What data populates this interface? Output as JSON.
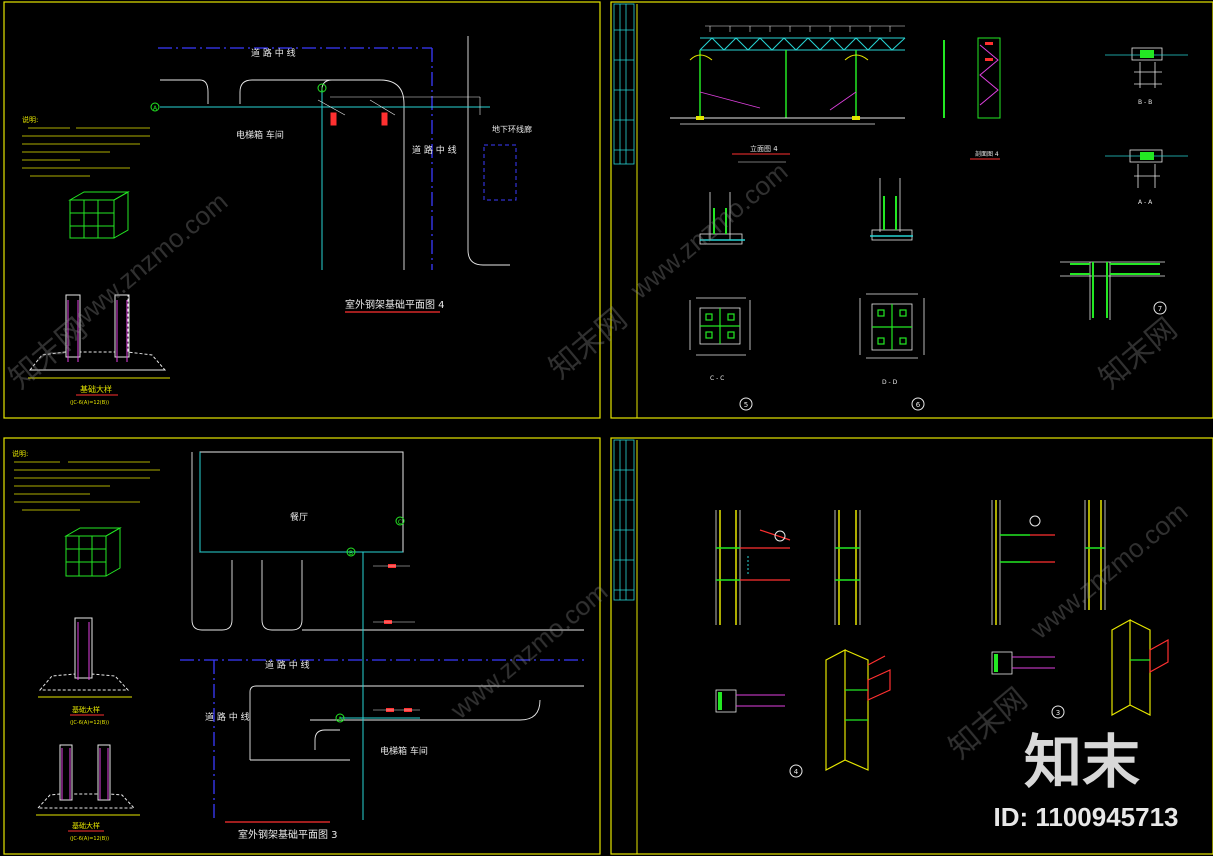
{
  "colors": {
    "frame": "#e6e600",
    "road": "#3b3bff",
    "cyan": "#27d3d3",
    "green": "#23e823",
    "white": "#e8e8e8",
    "magenta": "#e040e0",
    "red": "#ff3030",
    "watermark": "#8a8a8a"
  },
  "panel_tl": {
    "road_label_top": "道 路 中 线",
    "road_label_right": "道 路 中 线",
    "elevator_room": "电梯箱   车间",
    "corridor": "地下环线廊",
    "axis_a": "A",
    "axis_1": "1",
    "title": "室外钢架基础平面图 4",
    "foundation_detail": "基础大样",
    "foundation_note": "(JC-6(A)=12(B))",
    "notes_heading": "说明:"
  },
  "panel_tr": {
    "elevation_title": "立面图 4",
    "side_title": "剖面图 4",
    "section_bb": "B - B",
    "section_aa": "A - A",
    "section_cc": "C - C",
    "section_dd": "D - D",
    "callout_5": "5",
    "callout_6": "6",
    "callout_7": "7"
  },
  "panel_bl": {
    "notes_heading": "说明:",
    "restaurant": "餐厅",
    "road_label_mid": "道 路 中 线",
    "road_label_left": "道 路 中 线",
    "elevator_room": "电梯箱   车间",
    "axis_a": "A",
    "axis_b": "B",
    "axis_c": "C",
    "title": "室外钢架基础平面图 3",
    "foundation_detail_1": "基础大样",
    "foundation_detail_2": "基础大样",
    "foundation_note_1": "(JC-6(A)=12(B))",
    "foundation_note_2": "(JC-6(A)=12(B))"
  },
  "panel_br": {
    "callout_4": "4",
    "callout_3": "3"
  },
  "watermark": {
    "site": "www.znzmo.com",
    "brand": "知末网",
    "logo": "知末",
    "id": "ID: 1100945713"
  }
}
